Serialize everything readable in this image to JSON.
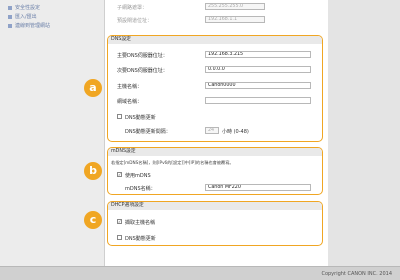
{
  "sidebar": {
    "items": [
      {
        "label": "安全性設定"
      },
      {
        "label": "匯入/匯出"
      },
      {
        "label": "連線到管理網站"
      }
    ]
  },
  "top": {
    "row1_label": "子網路遮罩：",
    "row1_value": "255.255.255.0",
    "row2_label": "預設閘道位址：",
    "row2_value": "192.168.1.1"
  },
  "dns": {
    "title": "DNS設定",
    "primary_label": "主要DNS伺服器位址：",
    "primary_value": "192.168.3.215",
    "secondary_label": "次要DNS伺服器位址：",
    "secondary_value": "0.0.0.0",
    "host_label": "主機名稱：",
    "host_value": "Canon0000",
    "domain_label": "網域名稱：",
    "domain_value": "",
    "dyn_label": "DNS動態更新",
    "interval_label": "DNS動態更新間隔：",
    "interval_value": "24",
    "interval_unit": "小時 (0-48)"
  },
  "mdns": {
    "title": "mDNS設定",
    "note": "若指定[mDNS名稱]，則[IPv6的[設定]]中[IP]的名稱也會被覆寫。",
    "use_label": "使用mDNS",
    "name_label": "mDNS名稱：",
    "name_value": "Canon MF220"
  },
  "dhcp": {
    "title": "DHCP選項設定",
    "host_label": "擷取主機名稱",
    "dyn_label": "DNS動態更新"
  },
  "badges": {
    "a": "a",
    "b": "b",
    "c": "c"
  },
  "footer": {
    "copyright": "Copyright CANON INC. 2014"
  },
  "colors": {
    "accent": "#f0a623"
  }
}
